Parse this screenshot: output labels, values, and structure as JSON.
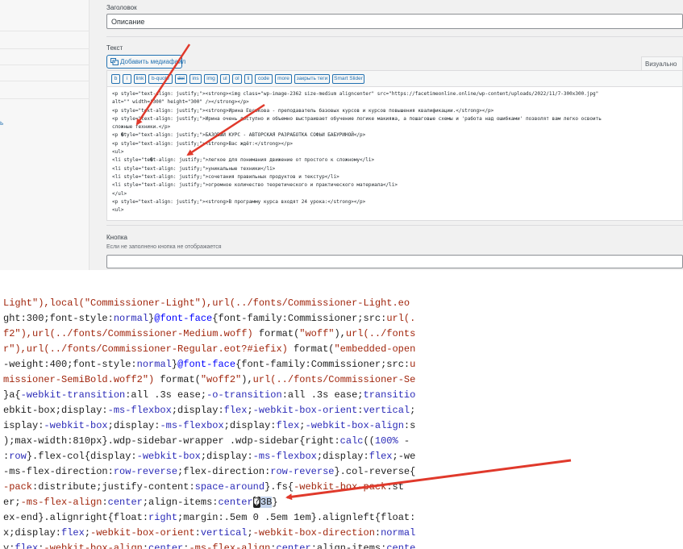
{
  "admin": {
    "heading_label": "Заголовок",
    "title_value": "Описание",
    "text_label": "Текст",
    "media_button": "Добавить медиафайл",
    "visual_tab": "Визуально",
    "sidebar_item": "ь",
    "quicktags": [
      "b",
      "i",
      "link",
      "b-quote",
      "del",
      "ins",
      "img",
      "ul",
      "ol",
      "li",
      "code",
      "more",
      "закрыть теги",
      "Smart Slider"
    ],
    "code_lines": [
      "<p style=\"text-align: justify;\"><strong><img class=\"wp-image-2362 size-medium aligncenter\" src=\"https://facetimeonline.online/wp-content/uploads/2022/11/7-300x300.jpg\"",
      "alt=\"\" width=\"300\" height=\"300\" /></strong></p>",
      "<p style=\"text-align: justify;\"><strong>Ирина Евсюкова - преподаватель базовых курсов и курсов повышения квалификации.</strong></p>",
      "<p style=\"text-align: justify;\">Ирина очень доступно и объемно выстраивает обучение логике макияжа, а пошаговые схемы и 'работа над ошибками' позволят вам легко освоить",
      "сложные техники.</p>",
      "<p �tyle=\"text-align: justify;\">БАЗОВЫЙ КУРС - АВТОРСКАЯ РАЗРАБОТКА СОФЬИ БАБУРИНОЙ</p>",
      "<p style=\"text-align: justify;\"><strong>Вас ждёт:</strong></p>",
      "<ul>",
      "<li style=\"te�t-align: justify;\">легкое для понимания движение от простого к сложному</li>",
      "<li style=\"text-align: justify;\">уникальные техники</li>",
      "<li style=\"text-align: justify;\">сочетания правильных продуктов и текстур</li>",
      "<li style=\"text-align: justify;\">огромное количество теоретического и практического материала</li>",
      "</ul>",
      "<p style=\"text-align: justify;\"><strong>В программу курса входят 24 урока:</strong></p>",
      "<ul>"
    ],
    "button_label": "Кнопка",
    "button_hint": "Если не заполнено кнопка не отображается"
  },
  "css_view": {
    "lines": [
      [
        [
          "r",
          "Light\"),local(\"Commissioner-Light\"),url(../fonts/Commissioner-Light.eo"
        ]
      ],
      [
        [
          "g",
          "ght:300;font-style:"
        ],
        [
          "p",
          "normal"
        ],
        [
          "g",
          "}"
        ],
        [
          "a",
          "@font-face"
        ],
        [
          "g",
          "{font-family:Commissioner;src:"
        ],
        [
          "r",
          "url(."
        ]
      ],
      [
        [
          "r",
          "f2\"),url(../fonts/Commissioner-Medium.woff)"
        ],
        [
          "g",
          " format("
        ],
        [
          "r",
          "\"woff\""
        ],
        [
          "g",
          "),"
        ],
        [
          "r",
          "url(../fonts"
        ]
      ],
      [
        [
          "r",
          "r\"),url(../fonts/Commissioner-Regular.eot?#iefix)"
        ],
        [
          "g",
          " format("
        ],
        [
          "r",
          "\"embedded-open"
        ]
      ],
      [
        [
          "g",
          "-weight:400;font-style:"
        ],
        [
          "p",
          "normal"
        ],
        [
          "g",
          "}"
        ],
        [
          "a",
          "@font-face"
        ],
        [
          "g",
          "{font-family:Commissioner;src:"
        ],
        [
          "r",
          "u"
        ]
      ],
      [
        [
          "r",
          "missioner-SemiBold.woff2\")"
        ],
        [
          "g",
          " format("
        ],
        [
          "r",
          "\"woff2\""
        ],
        [
          "g",
          "),"
        ],
        [
          "r",
          "url(../fonts/Commissioner-Sem"
        ]
      ],
      [
        [
          "g",
          "}a{"
        ],
        [
          "p",
          "-webkit-transition"
        ],
        [
          "g",
          ":all .3s ease;"
        ],
        [
          "p",
          "-o-transition"
        ],
        [
          "g",
          ":all .3s ease;"
        ],
        [
          "p",
          "transitio"
        ]
      ],
      [
        [
          "g",
          "ebkit-box;display:"
        ],
        [
          "p",
          "-ms-flexbox"
        ],
        [
          "g",
          ";display:"
        ],
        [
          "p",
          "flex"
        ],
        [
          "g",
          ";"
        ],
        [
          "p",
          "-webkit-box-orient"
        ],
        [
          "g",
          ":"
        ],
        [
          "p",
          "vertical"
        ],
        [
          "g",
          ";"
        ]
      ],
      [
        [
          "g",
          "isplay:"
        ],
        [
          "p",
          "-webkit-box"
        ],
        [
          "g",
          ";display:"
        ],
        [
          "p",
          "-ms-flexbox"
        ],
        [
          "g",
          ";display:"
        ],
        [
          "p",
          "flex"
        ],
        [
          "g",
          ";"
        ],
        [
          "p",
          "-webkit-box-align"
        ],
        [
          "g",
          ":s"
        ]
      ],
      [
        [
          "g",
          ");max-width:810px}.wdp-sidebar-wrapper .wdp-sidebar{right:"
        ],
        [
          "p",
          "calc"
        ],
        [
          "g",
          "(("
        ],
        [
          "p",
          "100%"
        ],
        [
          "g",
          " -"
        ]
      ],
      [
        [
          "g",
          ":"
        ],
        [
          "p",
          "row"
        ],
        [
          "g",
          "}.flex-col{display:"
        ],
        [
          "p",
          "-webkit-box"
        ],
        [
          "g",
          ";display:"
        ],
        [
          "p",
          "-ms-flexbox"
        ],
        [
          "g",
          ";display:"
        ],
        [
          "p",
          "flex"
        ],
        [
          "g",
          ";-we"
        ]
      ],
      [
        [
          "g",
          "-ms-flex-direction:"
        ],
        [
          "p",
          "row-reverse"
        ],
        [
          "g",
          ";flex-direction:"
        ],
        [
          "p",
          "row-reverse"
        ],
        [
          "g",
          "}.col-reverse{"
        ]
      ],
      [
        [
          "r",
          "-pack"
        ],
        [
          "g",
          ":distribute;justify-content:"
        ],
        [
          "p",
          "space-around"
        ],
        [
          "g",
          "}.fs{"
        ],
        [
          "r",
          "-webkit-box-pack"
        ],
        [
          "g",
          ":st"
        ]
      ],
      [
        [
          "g",
          "er;"
        ],
        [
          "r",
          "-ms-flex-align"
        ],
        [
          "g",
          ":"
        ],
        [
          "p",
          "center"
        ],
        [
          "g",
          ";align-items:"
        ],
        [
          "p",
          "center"
        ],
        [
          "x",
          "�"
        ],
        [
          "h",
          "3B"
        ],
        [
          "g",
          "}"
        ]
      ],
      [
        [
          "g",
          "ex-end}.alignright{float:"
        ],
        [
          "p",
          "right"
        ],
        [
          "g",
          ";margin:.5em 0 .5em 1em}.alignleft{float:"
        ]
      ],
      [
        [
          "g",
          "x;display:"
        ],
        [
          "p",
          "flex"
        ],
        [
          "g",
          ";"
        ],
        [
          "r",
          "-webkit-box-orient"
        ],
        [
          "g",
          ":"
        ],
        [
          "p",
          "vertical"
        ],
        [
          "g",
          ";"
        ],
        [
          "r",
          "-webkit-box-direction"
        ],
        [
          "g",
          ":"
        ],
        [
          "p",
          "normal"
        ]
      ],
      [
        [
          "g",
          "y:"
        ],
        [
          "p",
          "flex"
        ],
        [
          "g",
          ";"
        ],
        [
          "r",
          "-webkit-box-align"
        ],
        [
          "g",
          ":"
        ],
        [
          "p",
          "center"
        ],
        [
          "g",
          ";"
        ],
        [
          "r",
          "-ms-flex-align"
        ],
        [
          "g",
          ":"
        ],
        [
          "p",
          "center"
        ],
        [
          "g",
          ";align-items:"
        ],
        [
          "p",
          "cente"
        ]
      ]
    ]
  },
  "colors": {
    "arrow": "#e0392b",
    "accent": "#2271b1"
  }
}
